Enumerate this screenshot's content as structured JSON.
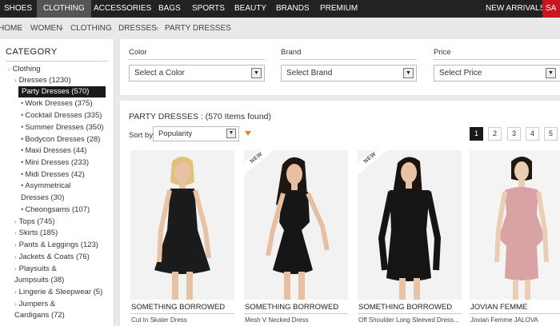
{
  "topnav": {
    "items": [
      "SHOES",
      "CLOTHING",
      "ACCESSORIES",
      "BAGS",
      "SPORTS",
      "BEAUTY",
      "BRANDS",
      "PREMIUM"
    ],
    "right": "NEW ARRIVALS",
    "sale": "SA"
  },
  "breadcrumb": [
    "HOME",
    "WOMEN",
    "CLOTHING",
    "DRESSES",
    "PARTY DRESSES"
  ],
  "sidebar": {
    "heading": "CATEGORY",
    "clothing": "Clothing",
    "dresses": "Dresses  (1230)",
    "selected": "Party Dresses  (570)",
    "subitems": [
      "Work Dresses  (375)",
      "Cocktail Dresses  (335)",
      "Summer Dresses  (350)",
      "Bodycon Dresses  (28)",
      "Maxi Dresses  (44)",
      "Mini Dresses  (233)",
      "Midi Dresses  (42)",
      "Asymmetrical",
      "Dresses  (30)",
      "Cheongsams  (107)"
    ],
    "cats": [
      "Tops  (745)",
      "Skirts  (185)",
      "Pants & Leggings  (123)",
      "Jackets & Coats  (76)",
      "Playsuits &",
      "Jumpsuits  (38)",
      "Lingerie & Sleepwear  (5)",
      "Jumpers &",
      "Cardigans  (72)"
    ]
  },
  "filters": {
    "color": {
      "label": "Color",
      "value": "Select a Color"
    },
    "brand": {
      "label": "Brand",
      "value": "Select Brand"
    },
    "price": {
      "label": "Price",
      "value": "Select Price"
    }
  },
  "listing": {
    "title": "PARTY DRESSES : (570 Items found)",
    "sort_label": "Sort by",
    "sort_value": "Popularity",
    "pages": [
      "1",
      "2",
      "3",
      "4",
      "5"
    ],
    "new_tag": "NEW"
  },
  "products": [
    {
      "brand": "SOMETHING BORROWED",
      "name": "Cut In Skater Dress"
    },
    {
      "brand": "SOMETHING BORROWED",
      "name": "Mesh V Necked Dress"
    },
    {
      "brand": "SOMETHING BORROWED",
      "name": "Off Shoulder Long Sleeved Dress..."
    },
    {
      "brand": "JOVIAN FEMME",
      "name": "Jovian Femme JALOVA"
    }
  ],
  "colors": {
    "nav_bg": "#222222",
    "sale": "#c7171e",
    "accent": "#e08a16",
    "dress_pink": "#d9a2a4"
  }
}
